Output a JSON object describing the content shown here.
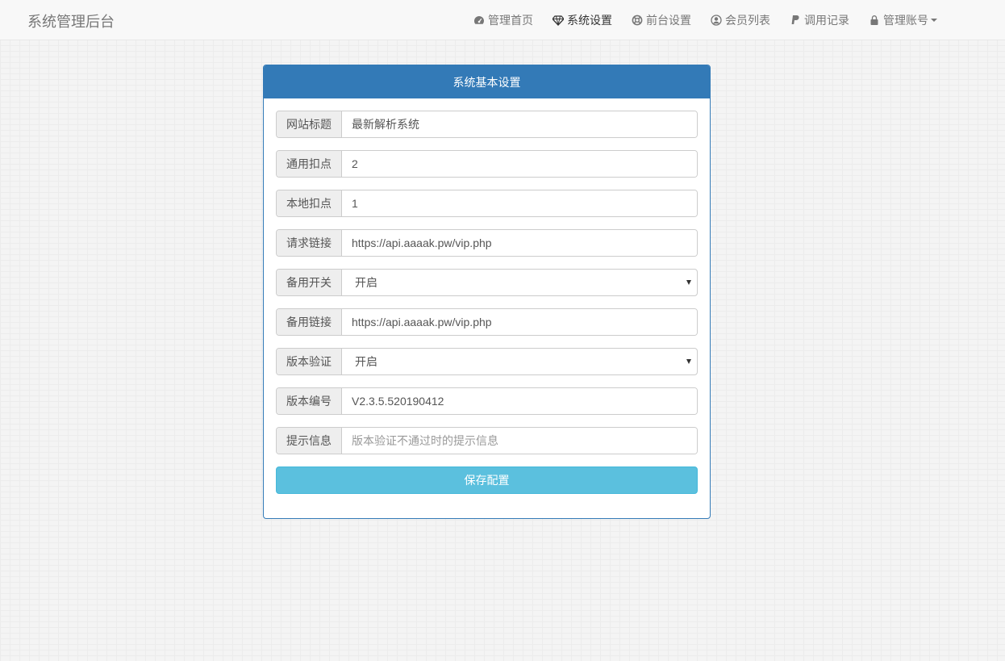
{
  "brand": "系统管理后台",
  "nav": {
    "home": "管理首页",
    "system": "系统设置",
    "front": "前台设置",
    "members": "会员列表",
    "logs": "调用记录",
    "account": "管理账号"
  },
  "panel": {
    "title": "系统基本设置",
    "fields": {
      "site_title": {
        "label": "网站标题",
        "value": "最新解析系统"
      },
      "common_deduct": {
        "label": "通用扣点",
        "value": "2"
      },
      "local_deduct": {
        "label": "本地扣点",
        "value": "1"
      },
      "request_url": {
        "label": "请求链接",
        "value": "https://api.aaaak.pw/vip.php"
      },
      "backup_switch": {
        "label": "备用开关",
        "value": "开启"
      },
      "backup_url": {
        "label": "备用链接",
        "value": "https://api.aaaak.pw/vip.php"
      },
      "version_check": {
        "label": "版本验证",
        "value": "开启"
      },
      "version_number": {
        "label": "版本编号",
        "value": "V2.3.5.520190412"
      },
      "tip_message": {
        "label": "提示信息",
        "value": "",
        "placeholder": "版本验证不通过时的提示信息"
      }
    },
    "save_label": "保存配置"
  },
  "colors": {
    "primary": "#337ab7",
    "info": "#5bc0de"
  }
}
